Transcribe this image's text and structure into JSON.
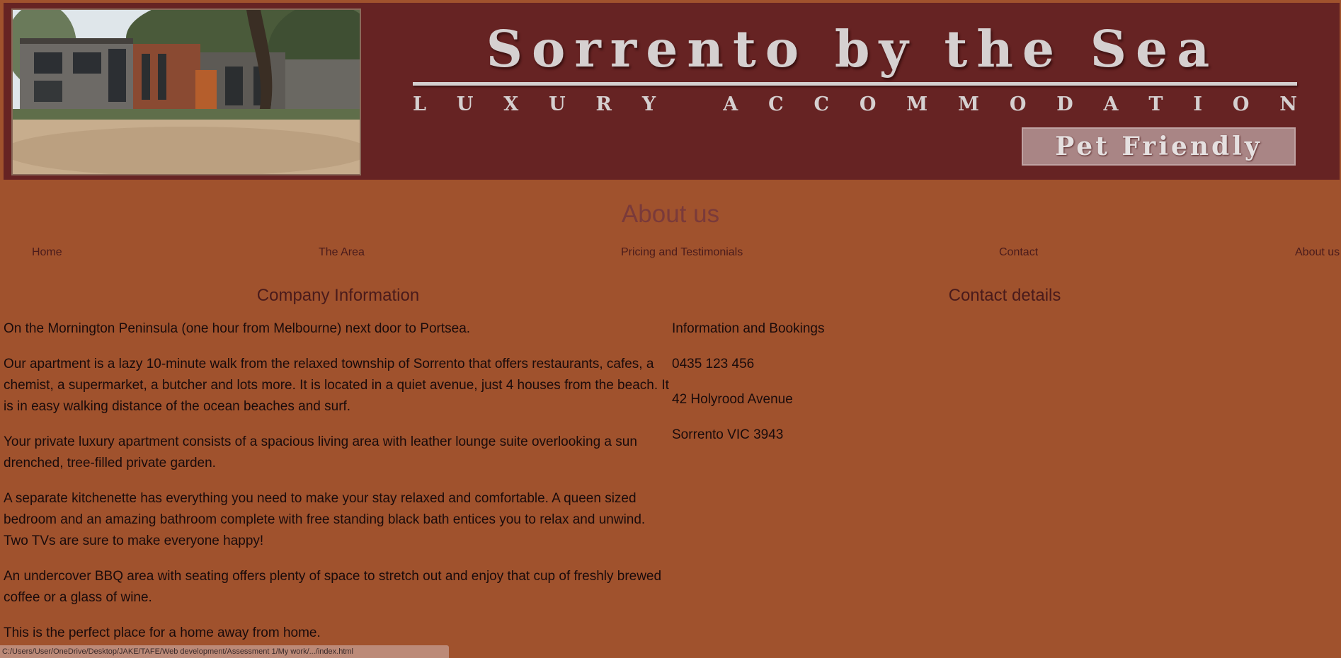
{
  "banner": {
    "title": "Sorrento by the Sea",
    "subtitle_letters": [
      "L",
      "U",
      "X",
      "U",
      "R",
      "Y",
      " ",
      "A",
      "C",
      "C",
      "O",
      "M",
      "M",
      "O",
      "D",
      "A",
      "T",
      "I",
      "O",
      "N"
    ],
    "badge": "Pet Friendly",
    "photo_icon": "building-photo",
    "colors": {
      "banner_bg": "#662323",
      "lettering": "#d5d0d0",
      "badge_bg": "#a98585"
    }
  },
  "page": {
    "title": "About us",
    "background": "#a0522d"
  },
  "nav": {
    "items": [
      {
        "label": "Home"
      },
      {
        "label": "The Area"
      },
      {
        "label": "Pricing and Testimonials"
      },
      {
        "label": "Contact"
      },
      {
        "label": "About us"
      }
    ]
  },
  "company": {
    "heading": "Company Information",
    "paragraphs": [
      "On the Mornington Peninsula (one hour from Melbourne) next door to Portsea.",
      "Our apartment is a lazy 10-minute walk from the relaxed township of Sorrento that offers restaurants, cafes, a chemist, a supermarket, a butcher and lots more. It is located in a quiet avenue, just 4 houses from the beach. It is in easy walking distance of the ocean beaches and surf.",
      "Your private luxury apartment consists of a spacious living area with leather lounge suite overlooking a sun drenched, tree-filled private garden.",
      "A separate kitchenette has everything you need to make your stay relaxed and comfortable. A queen sized bedroom and an amazing bathroom complete with free standing black bath entices you to relax and unwind. Two TVs are sure to make everyone happy!",
      "An undercover BBQ area with seating offers plenty of space to stretch out and enjoy that cup of freshly brewed coffee or a glass of wine.",
      "This is the perfect place for a home away from home."
    ]
  },
  "contact": {
    "heading": "Contact details",
    "lines": [
      "Information and Bookings",
      "0435 123 456",
      "42 Holyrood Avenue",
      "Sorrento VIC 3943"
    ]
  },
  "status_bar": {
    "url": "C:/Users/User/OneDrive/Desktop/JAKE/TAFE/Web development/Assessment 1/My work/.../index.html"
  }
}
